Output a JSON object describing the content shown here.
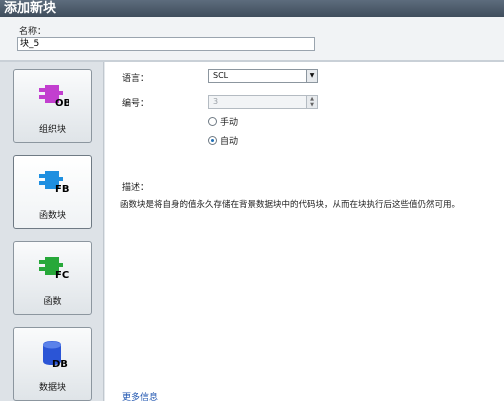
{
  "title": "添加新块",
  "name_field": {
    "label": "名称：",
    "value": "块_5"
  },
  "block_types": [
    {
      "label": "组织块",
      "badge": "OB",
      "color": "#c23fcf",
      "selected": false
    },
    {
      "label": "函数块",
      "badge": "FB",
      "color": "#1f8fe0",
      "selected": true
    },
    {
      "label": "函数",
      "badge": "FC",
      "color": "#27a83a",
      "selected": false
    },
    {
      "label": "数据块",
      "badge": "DB",
      "color": "#2b55d6",
      "selected": false
    }
  ],
  "language": {
    "label": "语言：",
    "value": "SCL"
  },
  "number": {
    "label": "编号：",
    "value": "3"
  },
  "radios": {
    "manual": "手动",
    "auto": "自动"
  },
  "description": {
    "label": "描述：",
    "text": "函数块是将自身的值永久存储在背景数据块中的代码块，从而在块执行后这些值仍然可用。"
  },
  "more_info": "更多信息"
}
